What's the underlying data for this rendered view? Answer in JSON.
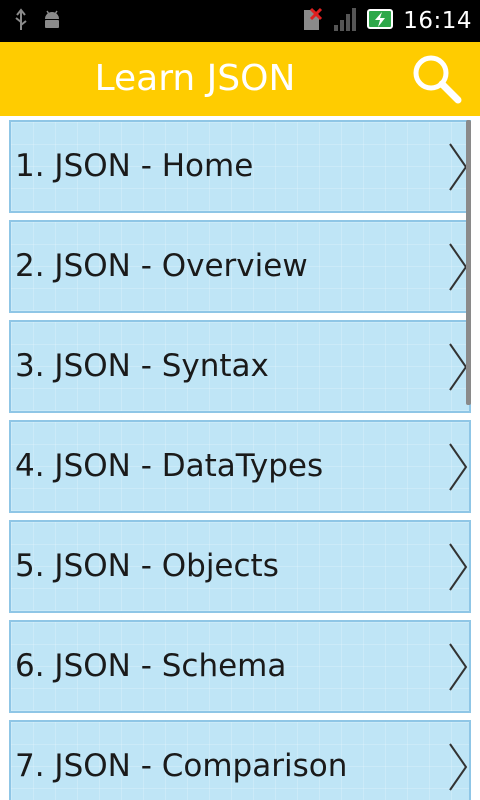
{
  "status_bar": {
    "time": "16:14",
    "icons": [
      "usb-icon",
      "android-debug-icon",
      "no-sim-icon",
      "signal-icon",
      "battery-charging-icon"
    ]
  },
  "app_bar": {
    "title": "Learn JSON",
    "search_icon": "search-icon",
    "accent_color": "#ffcc00"
  },
  "list": {
    "items": [
      {
        "label": "1. JSON - Home"
      },
      {
        "label": "2. JSON - Overview"
      },
      {
        "label": "3. JSON - Syntax"
      },
      {
        "label": "4. JSON - DataTypes"
      },
      {
        "label": "5. JSON - Objects"
      },
      {
        "label": "6. JSON - Schema"
      },
      {
        "label": "7. JSON - Comparison"
      }
    ],
    "item_color": "#bfe5f6",
    "item_border_color": "#8fc6e6"
  }
}
